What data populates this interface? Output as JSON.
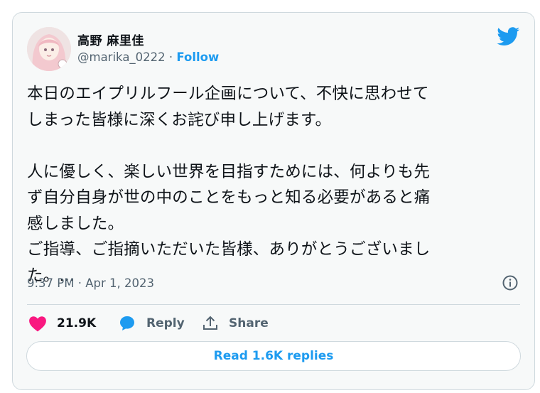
{
  "tweet": {
    "author_name": "高野 麻里佳",
    "handle": "@marika_0222",
    "separator": "·",
    "follow_label": "Follow",
    "text": "本日のエイプリルフール企画について、不快に思わせて\nしまった皆様に深くお詫び申し上げます。\n\n人に優しく、楽しい世界を目指すためには、何よりも先\nず自分自身が世の中のことをもっと知る必要があると痛\n感しました。\nご指導、ご指摘いただいた皆様、ありがとうございまし\nた。...",
    "timestamp": "9:37 PM · Apr 1, 2023"
  },
  "actions": {
    "like_count": "21.9K",
    "reply_label": "Reply",
    "share_label": "Share"
  },
  "replies_button_label": "Read 1.6K replies",
  "icons": {
    "brand": "twitter-bird-icon",
    "like": "heart-icon",
    "reply": "speech-bubble-icon",
    "share": "share-arrow-icon",
    "info": "info-icon"
  },
  "colors": {
    "accent": "#1d9bf0",
    "like": "#f91880",
    "muted_text": "#536471",
    "border": "#cfd9de",
    "card_background": "#f7f9f9"
  }
}
